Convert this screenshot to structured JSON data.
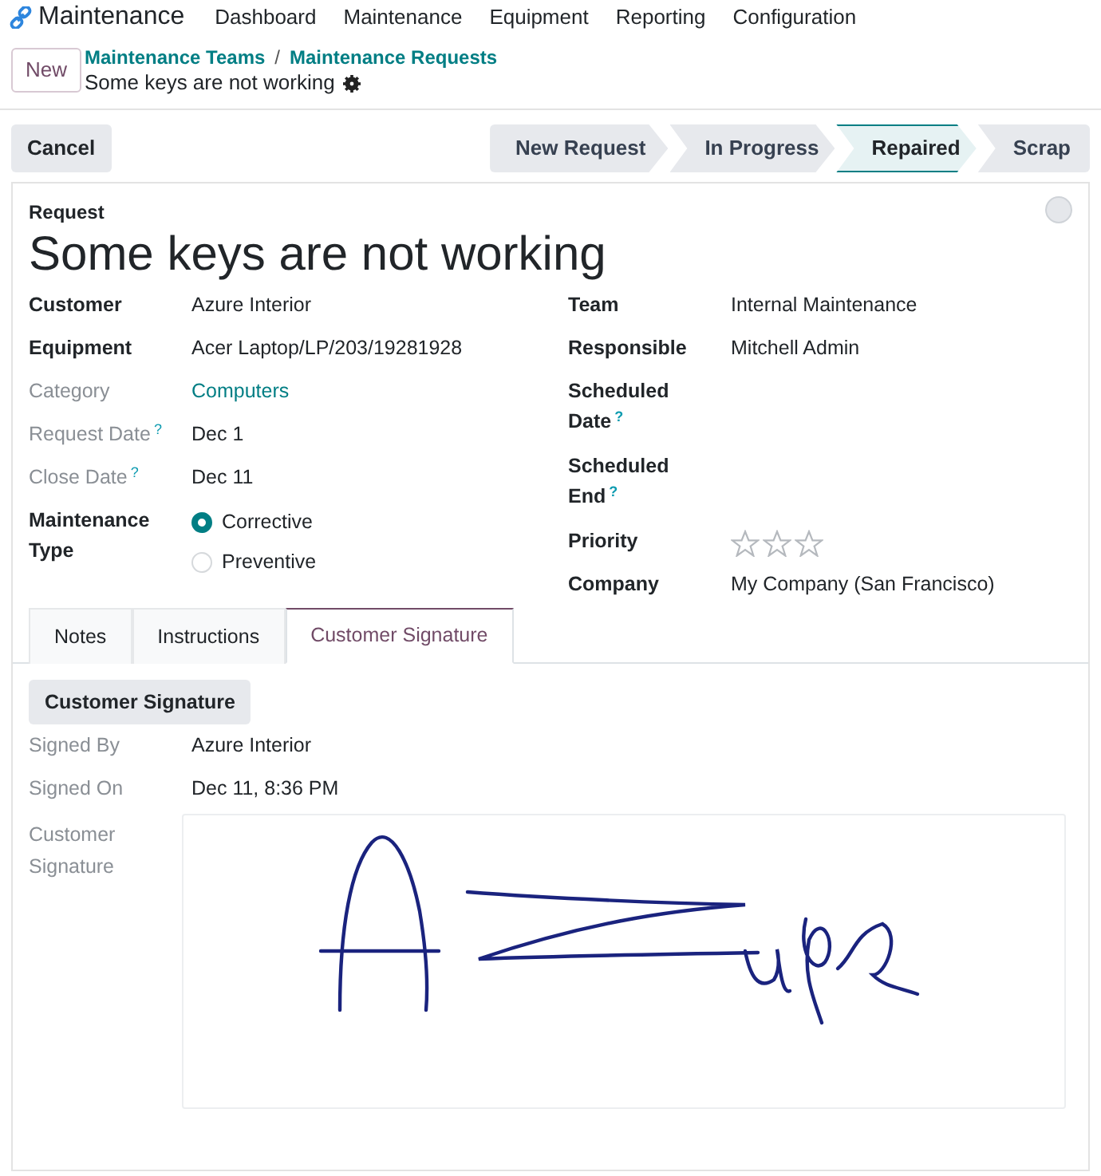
{
  "app": {
    "name": "Maintenance",
    "menu": [
      "Dashboard",
      "Maintenance",
      "Equipment",
      "Reporting",
      "Configuration"
    ]
  },
  "control_panel": {
    "new_button": "New",
    "breadcrumbs": [
      "Maintenance Teams",
      "Maintenance Requests"
    ],
    "breadcrumb_separator": "/",
    "record_title": "Some keys are not working"
  },
  "status_bar": {
    "buttons": [
      "Cancel"
    ],
    "stages": [
      {
        "label": "New Request",
        "selected": false
      },
      {
        "label": "In Progress",
        "selected": false
      },
      {
        "label": "Repaired",
        "selected": true
      },
      {
        "label": "Scrap",
        "selected": false
      }
    ]
  },
  "form": {
    "title_label": "Request",
    "title": "Some keys are not working",
    "done": false,
    "left_fields": [
      {
        "kind": "text",
        "label": "Customer",
        "value": "Azure Interior",
        "readonly": false
      },
      {
        "kind": "text",
        "label": "Equipment",
        "value": "Acer Laptop/LP/203/19281928",
        "readonly": false
      },
      {
        "kind": "link",
        "label": "Category",
        "value": "Computers",
        "readonly": true
      },
      {
        "kind": "text",
        "label": "Request Date",
        "help": "?",
        "value": "Dec 1",
        "readonly": true
      },
      {
        "kind": "text",
        "label": "Close Date",
        "help": "?",
        "value": "Dec 11",
        "readonly": true
      },
      {
        "kind": "radio",
        "label": "Maintenance Type",
        "readonly": false,
        "options": [
          {
            "label": "Corrective",
            "selected": true
          },
          {
            "label": "Preventive",
            "selected": false
          }
        ]
      }
    ],
    "right_fields": [
      {
        "kind": "text",
        "label": "Team",
        "value": "Internal Maintenance",
        "readonly": false
      },
      {
        "kind": "text",
        "label": "Responsible",
        "value": "Mitchell Admin",
        "readonly": false
      },
      {
        "kind": "empty",
        "label": "Scheduled Date",
        "help": "?",
        "readonly": false
      },
      {
        "kind": "empty",
        "label": "Scheduled End",
        "help": "?",
        "readonly": false
      },
      {
        "kind": "stars",
        "label": "Priority",
        "stars": 0,
        "readonly": false
      },
      {
        "kind": "text",
        "label": "Company",
        "value": "My Company (San Francisco)",
        "readonly": false
      }
    ],
    "tabs": [
      {
        "label": "Notes",
        "selected": false
      },
      {
        "label": "Instructions",
        "selected": false
      },
      {
        "label": "Customer Signature",
        "selected": true
      }
    ],
    "signature_tab": {
      "button": "Customer Signature",
      "fields": [
        {
          "label": "Signed By",
          "value": "Azure Interior"
        },
        {
          "label": "Signed On",
          "value": "Dec 11, 8:36 PM"
        }
      ],
      "signature_label": "Customer Signature"
    }
  }
}
